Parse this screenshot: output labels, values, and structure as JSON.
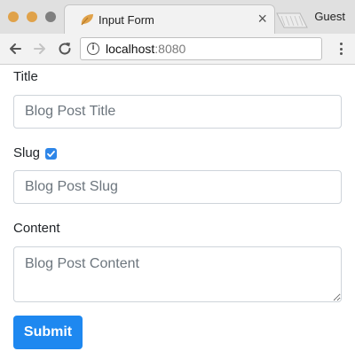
{
  "browser": {
    "tab_title": "Input Form",
    "profile": "Guest",
    "url_host": "localhost",
    "url_port": ":8080",
    "accent": "#e0a24a"
  },
  "form": {
    "title_label": "Title",
    "title_placeholder": "Blog Post Title",
    "slug_label": "Slug",
    "slug_checked": true,
    "slug_placeholder": "Blog Post Slug",
    "content_label": "Content",
    "content_placeholder": "Blog Post Content",
    "submit_label": "Submit"
  },
  "colors": {
    "primary": "#1e88f0",
    "checkbox": "#2f86e8"
  },
  "icons": [
    "favicon-icon",
    "close-icon",
    "back-icon",
    "forward-icon",
    "reload-icon",
    "info-icon",
    "menu-icon",
    "check-icon",
    "resize-grip-icon"
  ]
}
